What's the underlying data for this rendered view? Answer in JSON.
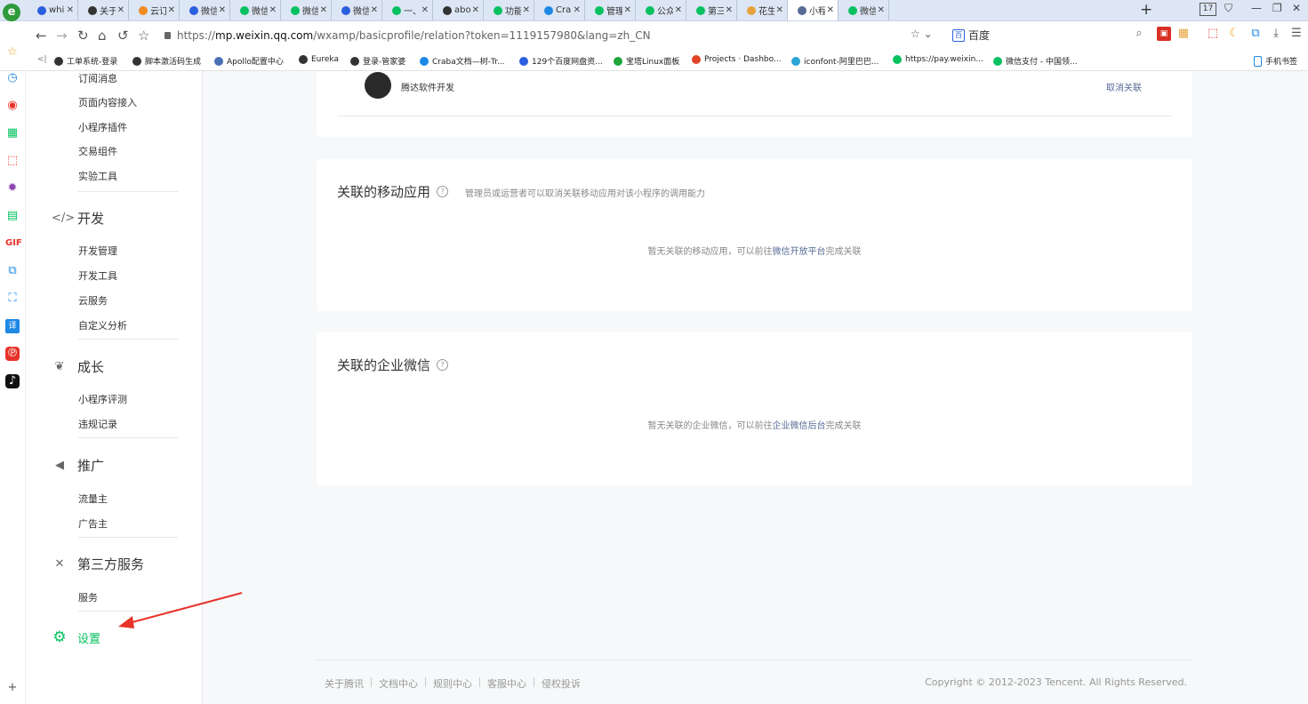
{
  "browser": {
    "logo": "e",
    "tabs": [
      {
        "title": "while",
        "icon": "paw-icon",
        "color": "#2a5fe0"
      },
      {
        "title": "关于j",
        "icon": "globe-icon",
        "color": "#333333"
      },
      {
        "title": "云订",
        "icon": "gear-icon",
        "color": "#f08a24"
      },
      {
        "title": "微信",
        "icon": "paw-icon",
        "color": "#2a5fe0"
      },
      {
        "title": "微信",
        "icon": "check-icon",
        "color": "#07c160"
      },
      {
        "title": "微信",
        "icon": "check-icon",
        "color": "#07c160"
      },
      {
        "title": "微信",
        "icon": "paw-icon",
        "color": "#2a5fe0"
      },
      {
        "title": "一、",
        "icon": "wechat-icon",
        "color": "#07c160"
      },
      {
        "title": "abou",
        "icon": "globe-icon",
        "color": "#333333"
      },
      {
        "title": "功能",
        "icon": "wechat-icon",
        "color": "#07c160"
      },
      {
        "title": "Crab",
        "icon": "grid-icon",
        "color": "#1e88e5"
      },
      {
        "title": "管理",
        "icon": "wechat-icon",
        "color": "#07c160"
      },
      {
        "title": "公众",
        "icon": "wechat-icon",
        "color": "#07c160"
      },
      {
        "title": "第三",
        "icon": "wechat-icon",
        "color": "#07c160"
      },
      {
        "title": "花生",
        "icon": "box-icon",
        "color": "#e6a23c"
      },
      {
        "title": "小程",
        "icon": "link-icon",
        "color": "#576b95",
        "active": true
      },
      {
        "title": "微信",
        "icon": "wechat-icon",
        "color": "#07c160"
      }
    ],
    "tab_close": "✕",
    "new_tab": "+",
    "tab_count": "17",
    "url_prefix": "https://",
    "url_host": "mp.weixin.qq.com",
    "url_path": "/wxamp/basicprofile/relation?token=1119157980&lang=zh_CN",
    "search_engine": "百度",
    "bookmarks": [
      {
        "label": "工单系统-登录",
        "color": "#333333"
      },
      {
        "label": "脚本激活码生成",
        "color": "#333333"
      },
      {
        "label": "Apollo配置中心",
        "color": "#4a6fb5"
      },
      {
        "label": "Eureka",
        "color": "#333333"
      },
      {
        "label": "登录-管家婆",
        "color": "#333333"
      },
      {
        "label": "Craba文档—树-Tr...",
        "color": "#1e88e5"
      },
      {
        "label": "129个百度网盘资...",
        "color": "#2a5fe0"
      },
      {
        "label": "宝塔Linux面板",
        "color": "#20a53a"
      },
      {
        "label": "Projects · Dashbo...",
        "color": "#e24329"
      },
      {
        "label": "iconfont-阿里巴巴...",
        "color": "#2aa4d5"
      },
      {
        "label": "https://pay.weixin...",
        "color": "#07c160"
      },
      {
        "label": "微信支付 - 中国领...",
        "color": "#07c160"
      }
    ],
    "mobile_bookmark": "手机书签"
  },
  "sidebar": {
    "top_items": [
      "订阅消息",
      "页面内容接入",
      "小程序插件",
      "交易组件",
      "实验工具"
    ],
    "groups": [
      {
        "title": "开发",
        "icon": "code-icon",
        "items": [
          "开发管理",
          "开发工具",
          "云服务",
          "自定义分析"
        ]
      },
      {
        "title": "成长",
        "icon": "sprout-icon",
        "items": [
          "小程序评测",
          "违规记录"
        ]
      },
      {
        "title": "推广",
        "icon": "megaphone-icon",
        "items": [
          "流量主",
          "广告主"
        ]
      },
      {
        "title": "第三方服务",
        "icon": "third-party-icon",
        "items": [
          "服务"
        ]
      }
    ],
    "settings": "设置"
  },
  "main": {
    "linked_account": {
      "name": "腾达软件开发",
      "action": "取消关联"
    },
    "mobile_apps": {
      "title": "关联的移动应用",
      "desc": "管理员或运营者可以取消关联移动应用对该小程序的调用能力",
      "empty_prefix": "暂无关联的移动应用，可以前往",
      "empty_link": "微信开放平台",
      "empty_suffix": "完成关联"
    },
    "wecom": {
      "title": "关联的企业微信",
      "empty_prefix": "暂无关联的企业微信，可以前往",
      "empty_link": "企业微信后台",
      "empty_suffix": "完成关联"
    }
  },
  "footer": {
    "links": [
      "关于腾讯",
      "文档中心",
      "规则中心",
      "客服中心",
      "侵权投诉"
    ],
    "copyright": "Copyright © 2012-2023 Tencent. All Rights Reserved."
  },
  "colors": {
    "accent": "#07c160",
    "link": "#576b95",
    "arrow": "#e8332a"
  }
}
